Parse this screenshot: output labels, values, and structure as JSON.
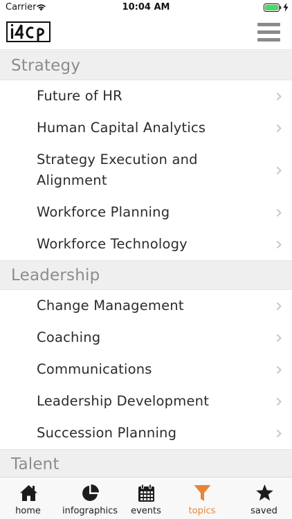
{
  "status_bar": {
    "carrier": "Carrier",
    "time": "10:04 AM",
    "icons": [
      "wifi-icon",
      "battery-icon",
      "charging-bolt-icon"
    ]
  },
  "nav_bar": {
    "logo_text": "i4cp",
    "menu_icon": "hamburger-menu-icon"
  },
  "sections": [
    {
      "title": "Strategy",
      "items": [
        {
          "label": "Future of HR"
        },
        {
          "label": "Human Capital Analytics"
        },
        {
          "label": "Strategy Execution and Alignment"
        },
        {
          "label": "Workforce Planning"
        },
        {
          "label": "Workforce Technology"
        }
      ]
    },
    {
      "title": "Leadership",
      "items": [
        {
          "label": "Change Management"
        },
        {
          "label": "Coaching"
        },
        {
          "label": "Communications"
        },
        {
          "label": "Leadership Development"
        },
        {
          "label": "Succession Planning"
        }
      ]
    },
    {
      "title": "Talent",
      "items": []
    }
  ],
  "tab_bar": {
    "tabs": [
      {
        "label": "home",
        "icon": "home-icon",
        "active": false
      },
      {
        "label": "infographics",
        "icon": "pie-chart-icon",
        "active": false
      },
      {
        "label": "events",
        "icon": "calendar-icon",
        "active": false
      },
      {
        "label": "topics",
        "icon": "filter-icon",
        "active": true
      },
      {
        "label": "saved",
        "icon": "star-icon",
        "active": false
      }
    ]
  },
  "colors": {
    "accent": "#e8843a",
    "section_header_bg": "#efefef",
    "section_header_text": "#8c8c8c",
    "tab_icon": "#1c1c1c"
  }
}
